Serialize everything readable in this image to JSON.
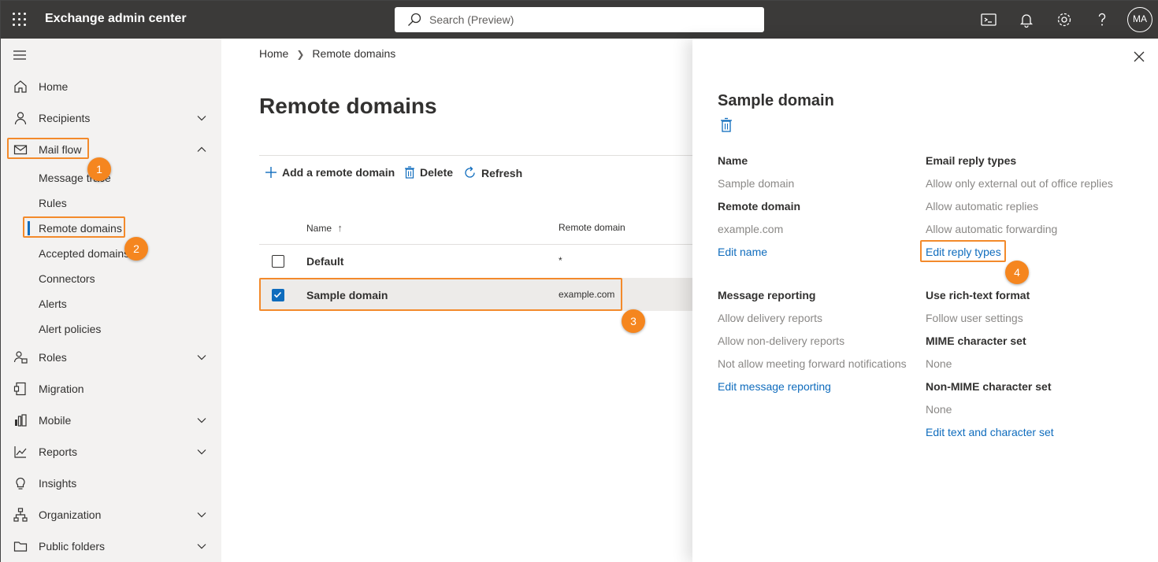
{
  "header": {
    "app_title": "Exchange admin center",
    "search_placeholder": "Search (Preview)",
    "avatar_initials": "MA",
    "icons": [
      "waffle-icon",
      "search-icon",
      "cloud-shell-icon",
      "bell-icon",
      "gear-icon",
      "help-icon"
    ]
  },
  "sidebar": {
    "items": [
      {
        "label": "Home",
        "icon": "home-icon"
      },
      {
        "label": "Recipients",
        "icon": "person-icon",
        "expandable": true
      },
      {
        "label": "Mail flow",
        "icon": "mail-icon",
        "expanded": true
      },
      {
        "label": "Roles",
        "icon": "roles-icon",
        "expandable": true
      },
      {
        "label": "Migration",
        "icon": "migration-icon"
      },
      {
        "label": "Mobile",
        "icon": "mobile-icon",
        "expandable": true
      },
      {
        "label": "Reports",
        "icon": "reports-icon",
        "expandable": true
      },
      {
        "label": "Insights",
        "icon": "lightbulb-icon"
      },
      {
        "label": "Organization",
        "icon": "organization-icon",
        "expandable": true
      },
      {
        "label": "Public folders",
        "icon": "folder-icon",
        "expandable": true
      }
    ],
    "mail_flow_subitems": [
      "Message trace",
      "Rules",
      "Remote domains",
      "Accepted domains",
      "Connectors",
      "Alerts",
      "Alert policies"
    ],
    "selected": "Remote domains"
  },
  "breadcrumb": {
    "home": "Home",
    "current": "Remote domains"
  },
  "page_title": "Remote domains",
  "commands": {
    "add": "Add a remote domain",
    "delete": "Delete",
    "refresh": "Refresh"
  },
  "table": {
    "columns": [
      "Name",
      "Remote domain"
    ],
    "sort_indicator": "↑",
    "rows": [
      {
        "name": "Default",
        "domain": "*",
        "checked": false
      },
      {
        "name": "Sample domain",
        "domain": "example.com",
        "checked": true
      }
    ]
  },
  "flyout": {
    "title": "Sample domain",
    "name_label": "Name",
    "name_value": "Sample domain",
    "remote_domain_label": "Remote domain",
    "remote_domain_value": "example.com",
    "edit_name": "Edit name",
    "email_reply_types_label": "Email reply types",
    "reply_values": [
      "Allow only external out of office replies",
      "Allow automatic replies",
      "Allow automatic forwarding"
    ],
    "edit_reply_types": "Edit reply types",
    "message_reporting_label": "Message reporting",
    "reporting_values": [
      "Allow delivery reports",
      "Allow non-delivery reports",
      "Not allow meeting forward notifications"
    ],
    "edit_message_reporting": "Edit message reporting",
    "rich_text_label": "Use rich-text format",
    "rich_text_value": "Follow user settings",
    "mime_label": "MIME character set",
    "mime_value": "None",
    "non_mime_label": "Non-MIME character set",
    "non_mime_value": "None",
    "edit_text_charset": "Edit text and character set"
  },
  "annotations": {
    "badges": [
      "1",
      "2",
      "3",
      "4"
    ],
    "highlight_color": "#f38a2b"
  },
  "colors": {
    "topbar": "#3b3a39",
    "sidebar": "#f3f2f1",
    "accent": "#0f6cbd",
    "badge": "#f5861f"
  }
}
